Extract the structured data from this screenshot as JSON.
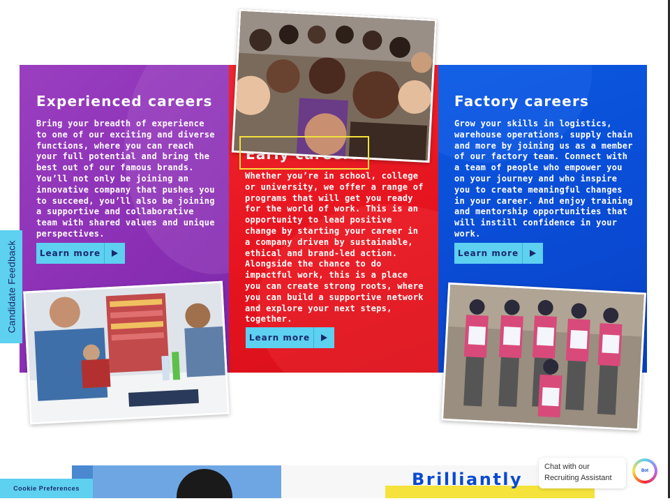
{
  "panels": {
    "experienced": {
      "title": "Experienced careers",
      "body": "Bring your breadth of experience to one of our exciting and diverse functions, where you can reach your full potential and bring the best out of our famous brands. You’ll not only be joining an innovative company that pushes you to succeed, you’ll also be joining a supportive and collaborative team with shared values and unique perspectives.",
      "button_label": "Learn more"
    },
    "early": {
      "title": "Early careers",
      "body": "Whether you’re in school, college or university, we offer a range of programs that will get you ready for the world of work. This is an opportunity to lead positive change by starting your career in a company driven by sustainable, ethical and brand-led action. Alongside the chance to do impactful work, this is a place you can create strong roots, where you can build a supportive network and explore your next steps, together.",
      "button_label": "Learn more"
    },
    "factory": {
      "title": "Factory careers",
      "body": "Grow your skills in logistics, warehouse operations, supply chain and more by joining us as a member of our factory team. Connect with a team of people who empower you on your journey and who inspire you to create meaningful changes in your career. And enjoy training and mentorship opportunities that will instill confidence in your work.",
      "button_label": "Learn more"
    }
  },
  "feedback_tab": "Candidate Feedback",
  "cookie_button": "Cookie Preferences",
  "banner_heading": "Brilliantly",
  "chat": {
    "prompt": "Chat with our Recruiting Assistant",
    "button_text": "Bot"
  },
  "colors": {
    "purple": "#8a2fb4",
    "red": "#e5141f",
    "blue": "#0a4ad3",
    "cyan_button": "#5ed0f0",
    "highlight": "#f5e23a"
  },
  "icons": [
    "play-arrow-icon",
    "chat-bot-icon"
  ]
}
